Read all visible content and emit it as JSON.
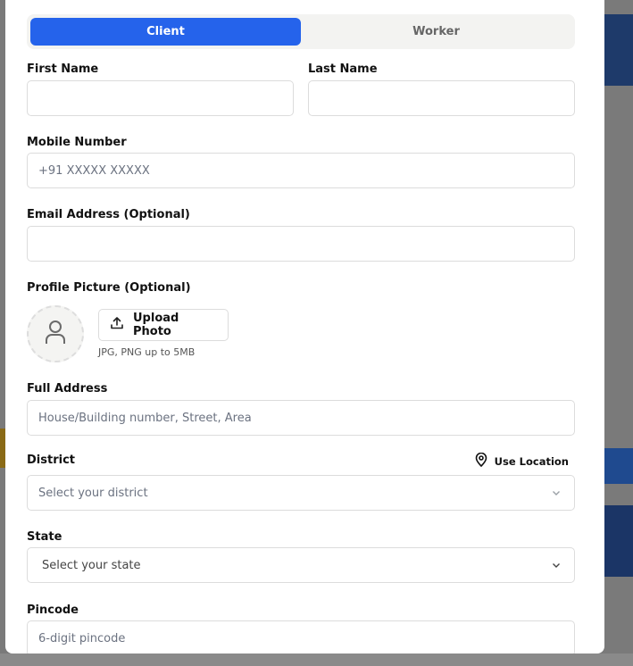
{
  "tabs": [
    {
      "label": "Client",
      "active": true
    },
    {
      "label": "Worker",
      "active": false
    }
  ],
  "form": {
    "first_name": {
      "label": "First Name",
      "value": "",
      "placeholder": ""
    },
    "last_name": {
      "label": "Last Name",
      "value": "",
      "placeholder": ""
    },
    "mobile": {
      "label": "Mobile Number",
      "placeholder": "+91 XXXXX XXXXX"
    },
    "email": {
      "label": "Email Address (Optional)",
      "placeholder": ""
    },
    "profile_picture": {
      "label": "Profile Picture (Optional)",
      "upload_label": "Upload Photo",
      "hint": "JPG, PNG up to 5MB"
    },
    "address": {
      "label": "Full Address",
      "placeholder": "House/Building number, Street, Area"
    },
    "district": {
      "label": "District",
      "placeholder": "Select your district",
      "use_location": "Use Location"
    },
    "state": {
      "label": "State",
      "placeholder": "Select your state"
    },
    "pincode": {
      "label": "Pincode",
      "placeholder": "6-digit pincode"
    }
  },
  "colors": {
    "accent": "#2563eb",
    "tabs_bg": "#f3f3f1",
    "border": "#dcdcdc"
  },
  "icons": [
    "user-icon",
    "upload-icon",
    "map-pin-icon",
    "chevron-down-icon"
  ]
}
